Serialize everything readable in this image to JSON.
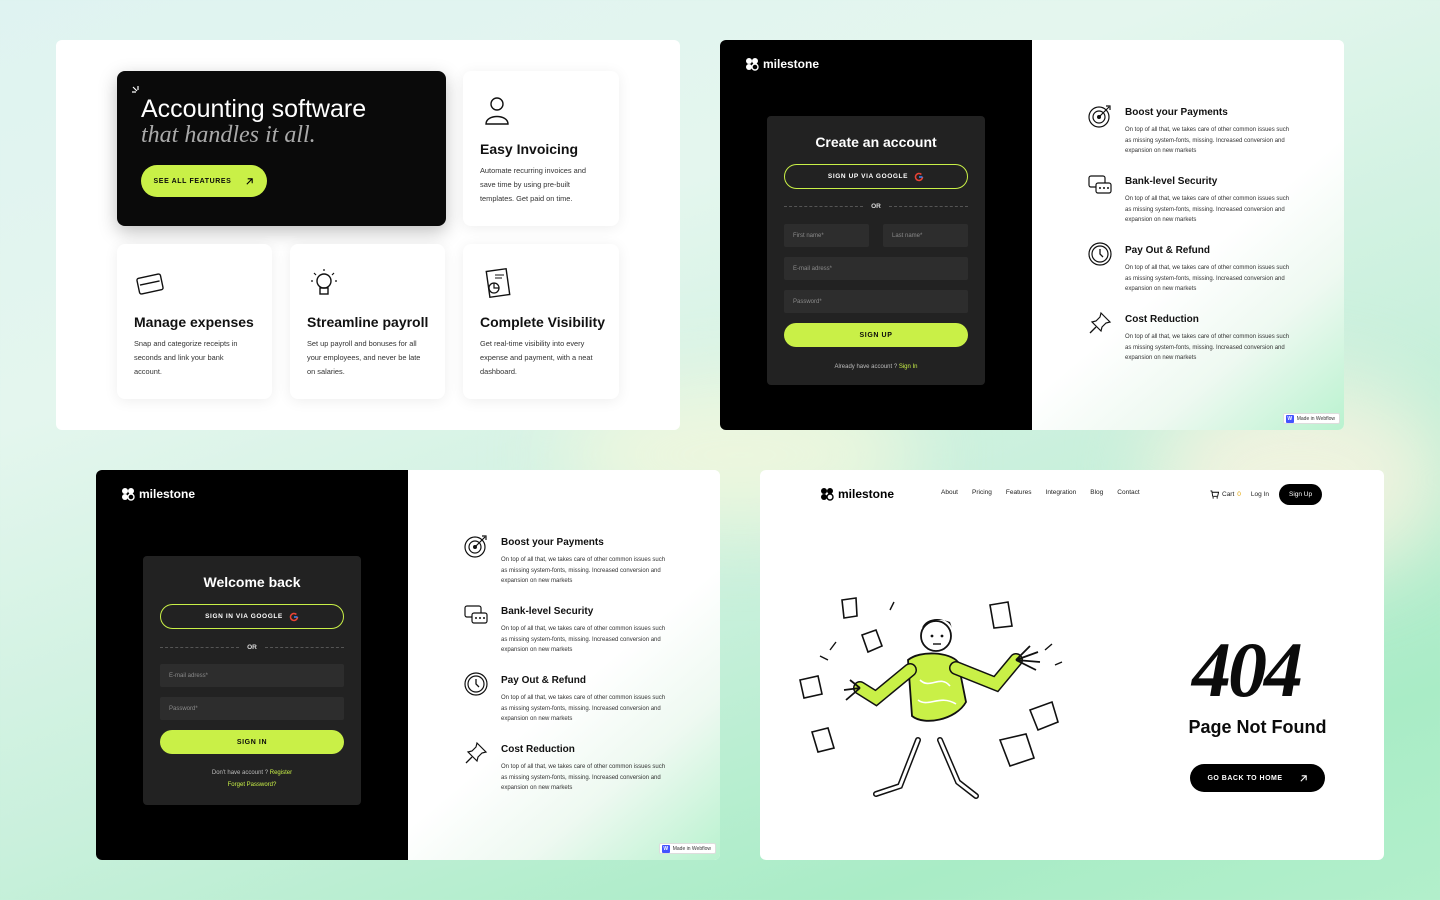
{
  "features_panel": {
    "hero": {
      "title": "Accounting software",
      "subtitle": "that handles it all.",
      "cta": "SEE ALL FEATURES"
    },
    "cards": [
      {
        "icon": "user-icon",
        "title": "Easy Invoicing",
        "desc": "Automate recurring invoices and save time by using pre-built templates. Get paid on time."
      },
      {
        "icon": "wallet-icon",
        "title": "Manage expenses",
        "desc": "Snap and categorize receipts in seconds and link your bank account."
      },
      {
        "icon": "lightbulb-icon",
        "title": "Streamline payroll",
        "desc": "Set up payroll and bonuses for all your employees, and never be late on salaries."
      },
      {
        "icon": "document-chart-icon",
        "title": "Complete Visibility",
        "desc": "Get real-time visibility into every expense and payment, with a neat dashboard."
      }
    ]
  },
  "brand": "milestone",
  "signup_panel": {
    "title": "Create an account",
    "google": "SIGN UP VIA GOOGLE",
    "or": "OR",
    "first_name": "First name*",
    "last_name": "Last name*",
    "email": "E-mail adress*",
    "password": "Password*",
    "submit": "SIGN UP",
    "footer_text": "Already have account ?",
    "footer_link": "Sign In"
  },
  "signin_panel": {
    "title": "Welcome back",
    "google": "SIGN IN VIA GOOGLE",
    "or": "OR",
    "email": "E-mail adress*",
    "password": "Password*",
    "submit": "SIGN IN",
    "footer_text": "Don't have account ?",
    "footer_link": "Register",
    "forgot": "Forget Password?"
  },
  "benefits": [
    {
      "icon": "target-icon",
      "title": "Boost your Payments",
      "desc": "On top of all that, we takes care of other common issues such as missing system-fonts, missing. Increased conversion and expansion on new markets"
    },
    {
      "icon": "chat-lock-icon",
      "title": "Bank-level Security",
      "desc": "On top of all that, we takes care of other common issues such as missing system-fonts, missing. Increased conversion and expansion on new markets"
    },
    {
      "icon": "clock-icon",
      "title": "Pay Out & Refund",
      "desc": "On top of all that, we takes care of other common issues such as missing system-fonts, missing. Increased conversion and expansion on new markets"
    },
    {
      "icon": "pushpin-icon",
      "title": "Cost Reduction",
      "desc": "On top of all that, we takes care of other common issues such as missing system-fonts, missing. Increased conversion and expansion on new markets"
    }
  ],
  "webflow_badge": "Made in Webflow",
  "notfound_panel": {
    "nav": [
      "About",
      "Pricing",
      "Features",
      "Integration",
      "Blog",
      "Contact"
    ],
    "cart_label": "Cart",
    "cart_count": "0",
    "login": "Log In",
    "signup": "Sign Up",
    "code": "404",
    "message": "Page Not Found",
    "cta": "GO BACK TO HOME"
  },
  "colors": {
    "accent": "#c9f047",
    "dark": "#0a0a0a",
    "panel_dark": "#222222"
  }
}
